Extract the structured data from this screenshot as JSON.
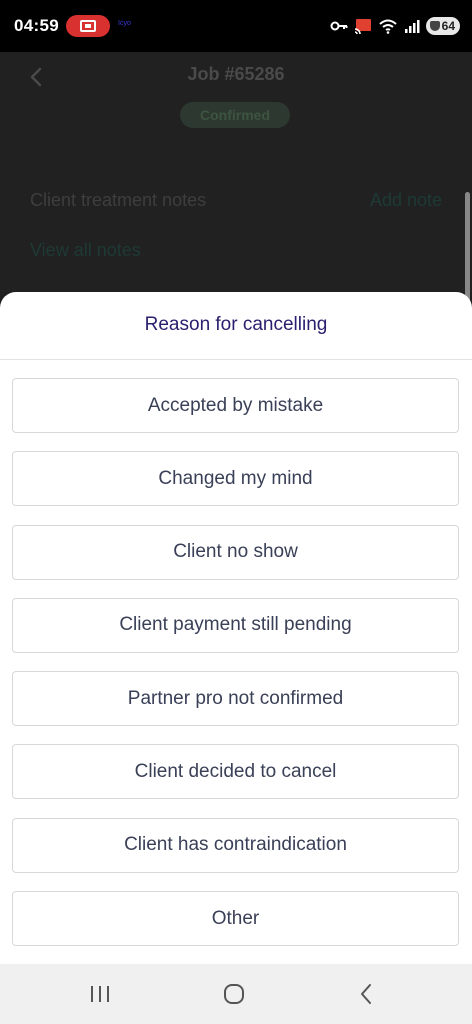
{
  "status_bar": {
    "time": "04:59",
    "tiny_label": "Icyo",
    "battery": "64"
  },
  "header": {
    "title": "Job #65286",
    "status": "Confirmed"
  },
  "notes": {
    "title": "Client treatment notes",
    "add_label": "Add note",
    "view_all_label": "View all notes"
  },
  "sheet": {
    "title": "Reason for cancelling",
    "reasons": [
      "Accepted by mistake",
      "Changed my mind",
      "Client no show",
      "Client payment still pending",
      "Partner pro not confirmed",
      "Client decided to cancel",
      "Client has contraindication",
      "Other"
    ]
  },
  "nav": {
    "icons": [
      "recent-apps-icon",
      "home-icon",
      "back-icon"
    ]
  }
}
